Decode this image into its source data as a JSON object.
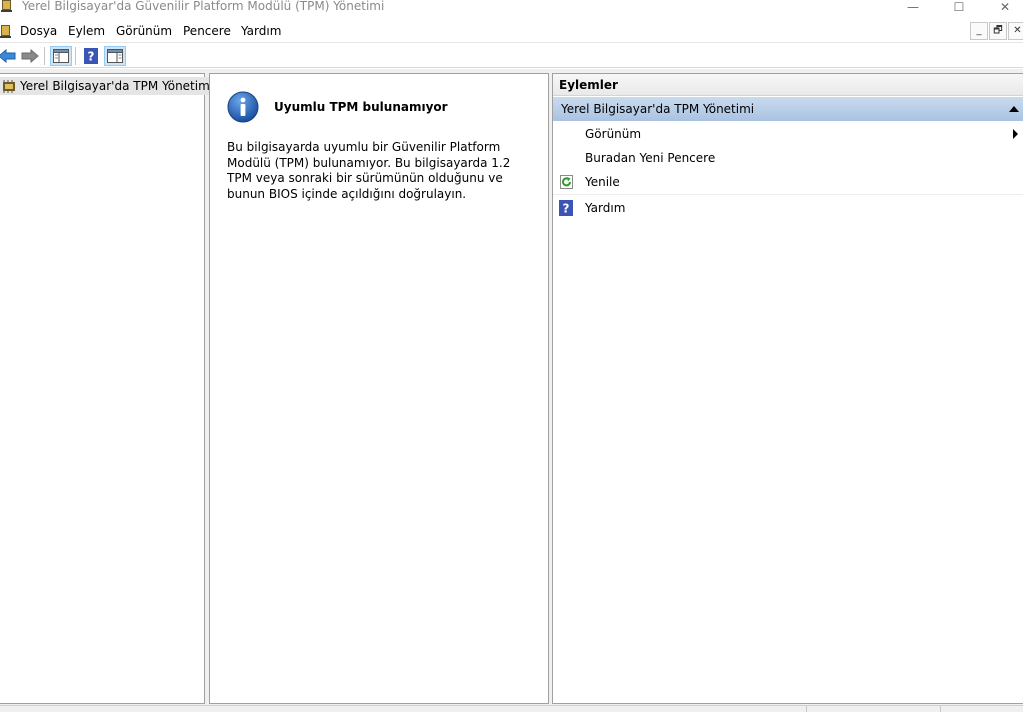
{
  "window": {
    "title": "Yerel Bilgisayar'da Güvenilir Platform Modülü (TPM) Yönetimi",
    "minimize_glyph": "—",
    "maximize_glyph": "☐",
    "close_glyph": "✕"
  },
  "menu": {
    "items": [
      {
        "label": "Dosya"
      },
      {
        "label": "Eylem"
      },
      {
        "label": "Görünüm"
      },
      {
        "label": "Pencere"
      },
      {
        "label": "Yardım"
      }
    ],
    "mdi_minimize": "_",
    "mdi_restore": "🗗",
    "mdi_close": "✕"
  },
  "toolbar": {
    "buttons": [
      "back-icon",
      "forward-icon",
      "console-tree-icon",
      "help-icon",
      "action-pane-icon"
    ]
  },
  "tree": {
    "root_label": "Yerel Bilgisayar'da TPM Yönetimi"
  },
  "content": {
    "title": "Uyumlu TPM bulunamıyor",
    "body": "Bu bilgisayarda uyumlu bir Güvenilir Platform Modülü (TPM) bulunamıyor. Bu bilgisayarda 1.2 TPM veya sonraki bir sürümünün olduğunu ve bunun BIOS içinde açıldığını doğrulayın."
  },
  "actions": {
    "header": "Eylemler",
    "section_title": "Yerel Bilgisayar'da TPM Yönetimi",
    "items": [
      {
        "label": "Görünüm",
        "icon": "",
        "has_submenu": true
      },
      {
        "label": "Buradan Yeni Pencere",
        "icon": "",
        "has_submenu": false
      },
      {
        "label": "Yenile",
        "icon": "refresh-icon",
        "has_submenu": false
      },
      {
        "label": "Yardım",
        "icon": "help-icon",
        "has_submenu": false
      }
    ]
  },
  "colors": {
    "section_bg": "#aac3e2",
    "pressed_button": "#cce4f7",
    "info_blue": "#1f5fb0"
  }
}
